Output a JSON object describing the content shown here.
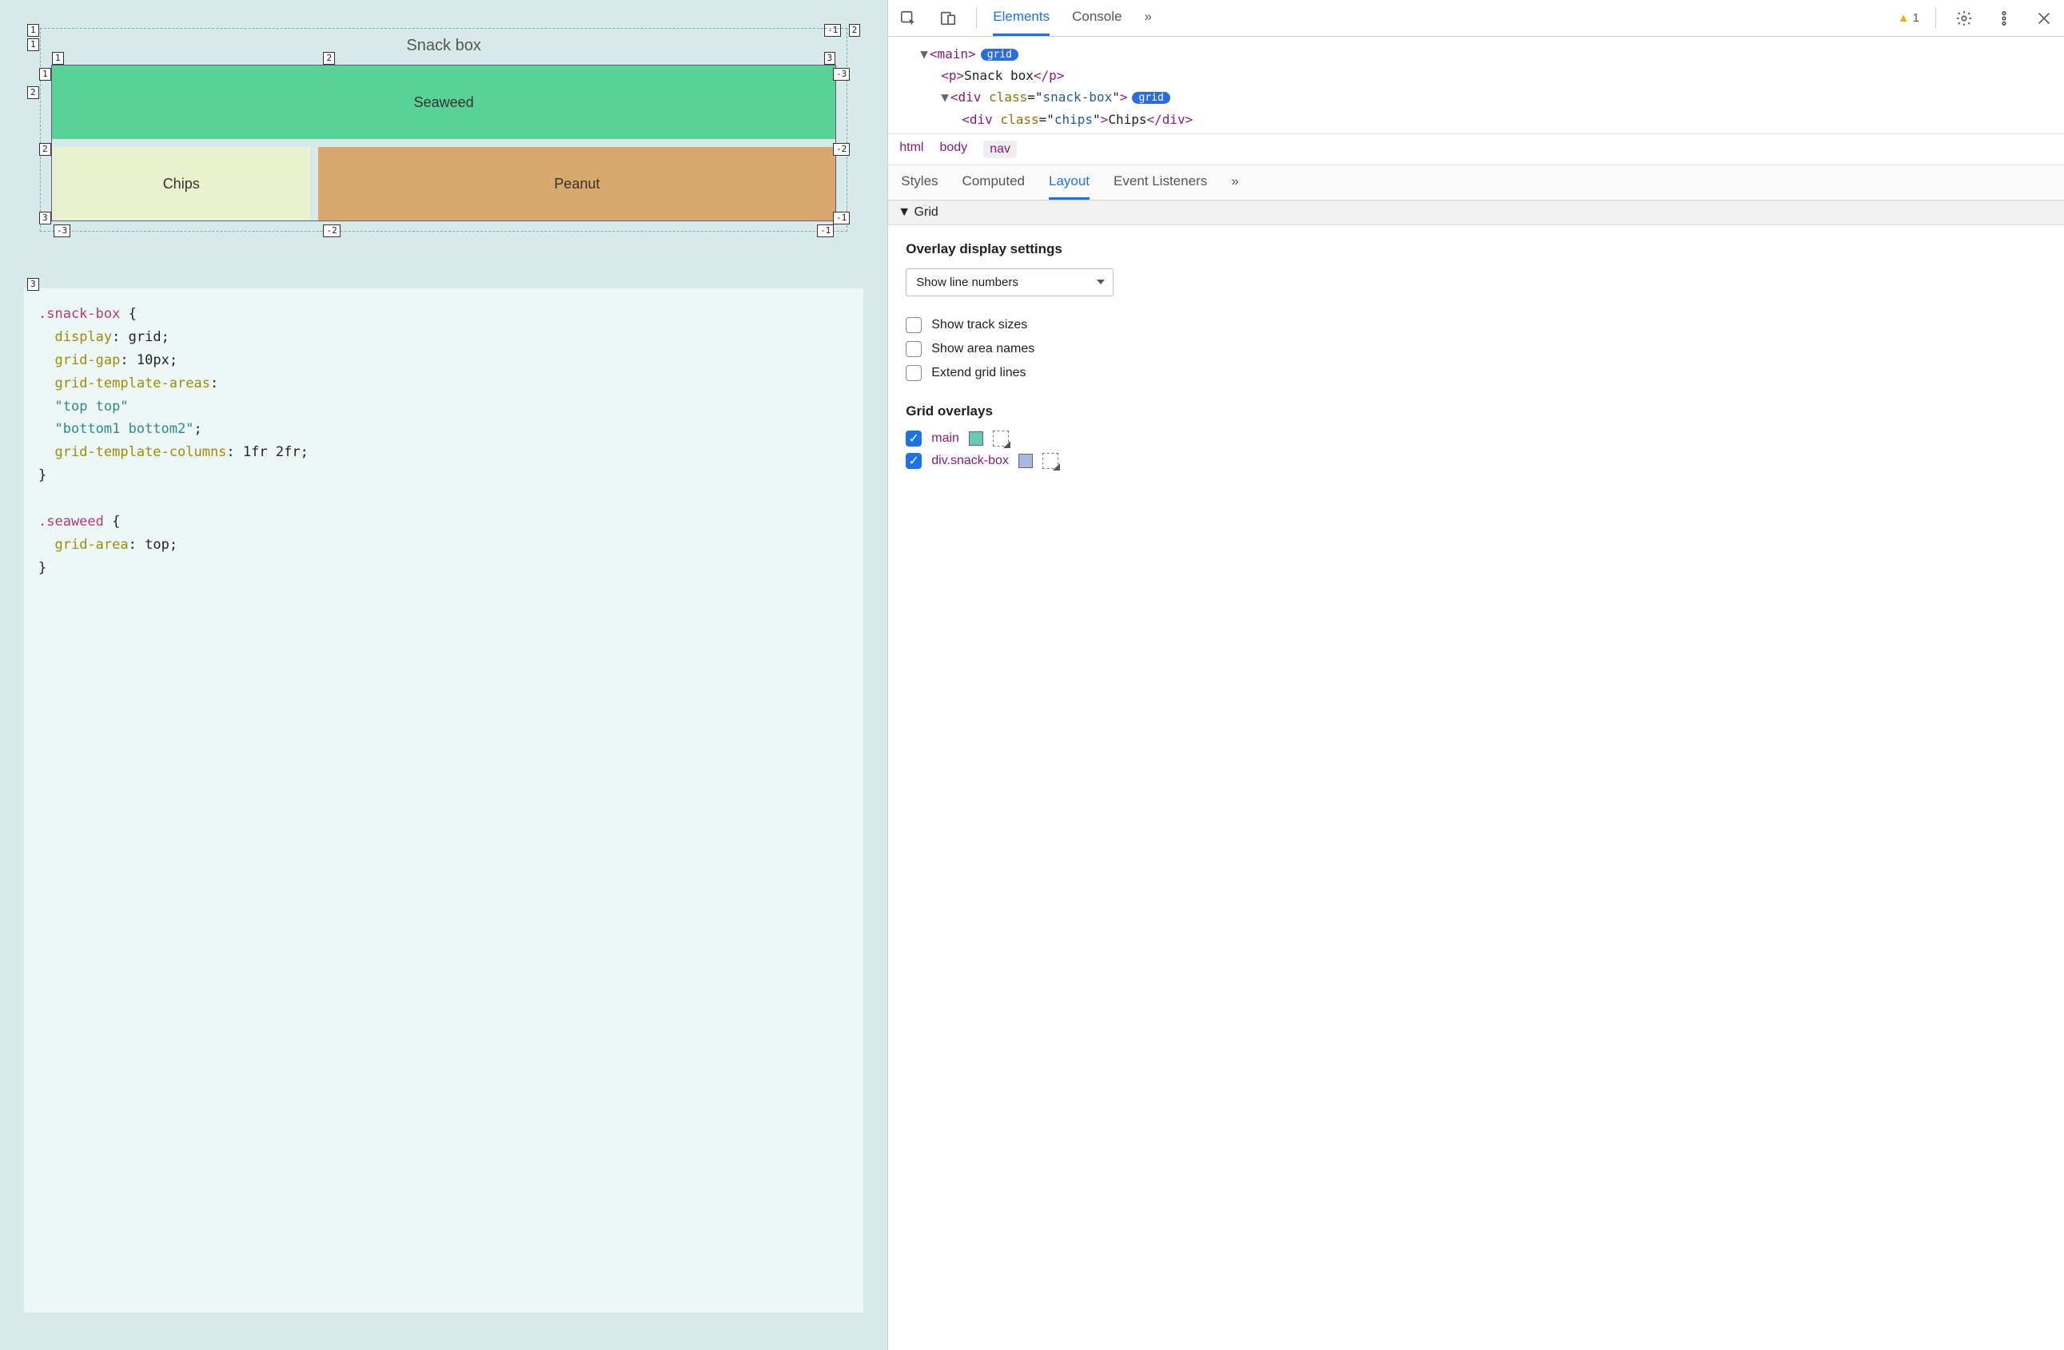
{
  "preview": {
    "title": "Snack box",
    "cells": {
      "seaweed": "Seaweed",
      "chips": "Chips",
      "peanut": "Peanut"
    },
    "outer_line_numbers": {
      "top_left": "1",
      "top_right_neg": "-1",
      "row2_left": "2",
      "bottom_left": "3"
    },
    "inner_line_numbers": {
      "top": [
        "1",
        "2",
        "3"
      ],
      "left": [
        "1",
        "2",
        "3"
      ],
      "right_neg": [
        "-3",
        "-2",
        "-1"
      ],
      "bottom_neg": [
        "-3",
        "-2",
        "-1"
      ]
    }
  },
  "code_block": ".snack-box {\n  display: grid;\n  grid-gap: 10px;\n  grid-template-areas:\n  \"top top\"\n  \"bottom1 bottom2\";\n  grid-template-columns: 1fr 2fr;\n}\n\n.seaweed {\n  grid-area: top;\n}",
  "devtools": {
    "tabs": {
      "elements": "Elements",
      "console": "Console",
      "more": "»"
    },
    "warning_count": "1",
    "dom": {
      "line1": {
        "caret": "▼",
        "tag_open": "<main>",
        "badge": "grid"
      },
      "line2": {
        "tag_open": "<p>",
        "text": "Snack box",
        "tag_close": "</p>"
      },
      "line3": {
        "caret": "▼",
        "tag": "div",
        "class": "snack-box",
        "badge": "grid"
      },
      "line4": {
        "tag": "div",
        "class": "chips",
        "text": "Chips",
        "tag_close": "</div>"
      }
    },
    "breadcrumb": [
      "html",
      "body",
      "nav"
    ],
    "subtabs": {
      "styles": "Styles",
      "computed": "Computed",
      "layout": "Layout",
      "events": "Event Listeners",
      "more": "»"
    },
    "layout_section": "Grid",
    "overlay_settings_title": "Overlay display settings",
    "select_value": "Show line numbers",
    "checks": {
      "track_sizes": "Show track sizes",
      "area_names": "Show area names",
      "extend": "Extend grid lines"
    },
    "grid_overlays_title": "Grid overlays",
    "overlays": [
      {
        "name": "main",
        "color": "#69c9b9",
        "checked": true
      },
      {
        "name": "div.snack-box",
        "color": "#a9b8e0",
        "checked": true
      }
    ]
  }
}
